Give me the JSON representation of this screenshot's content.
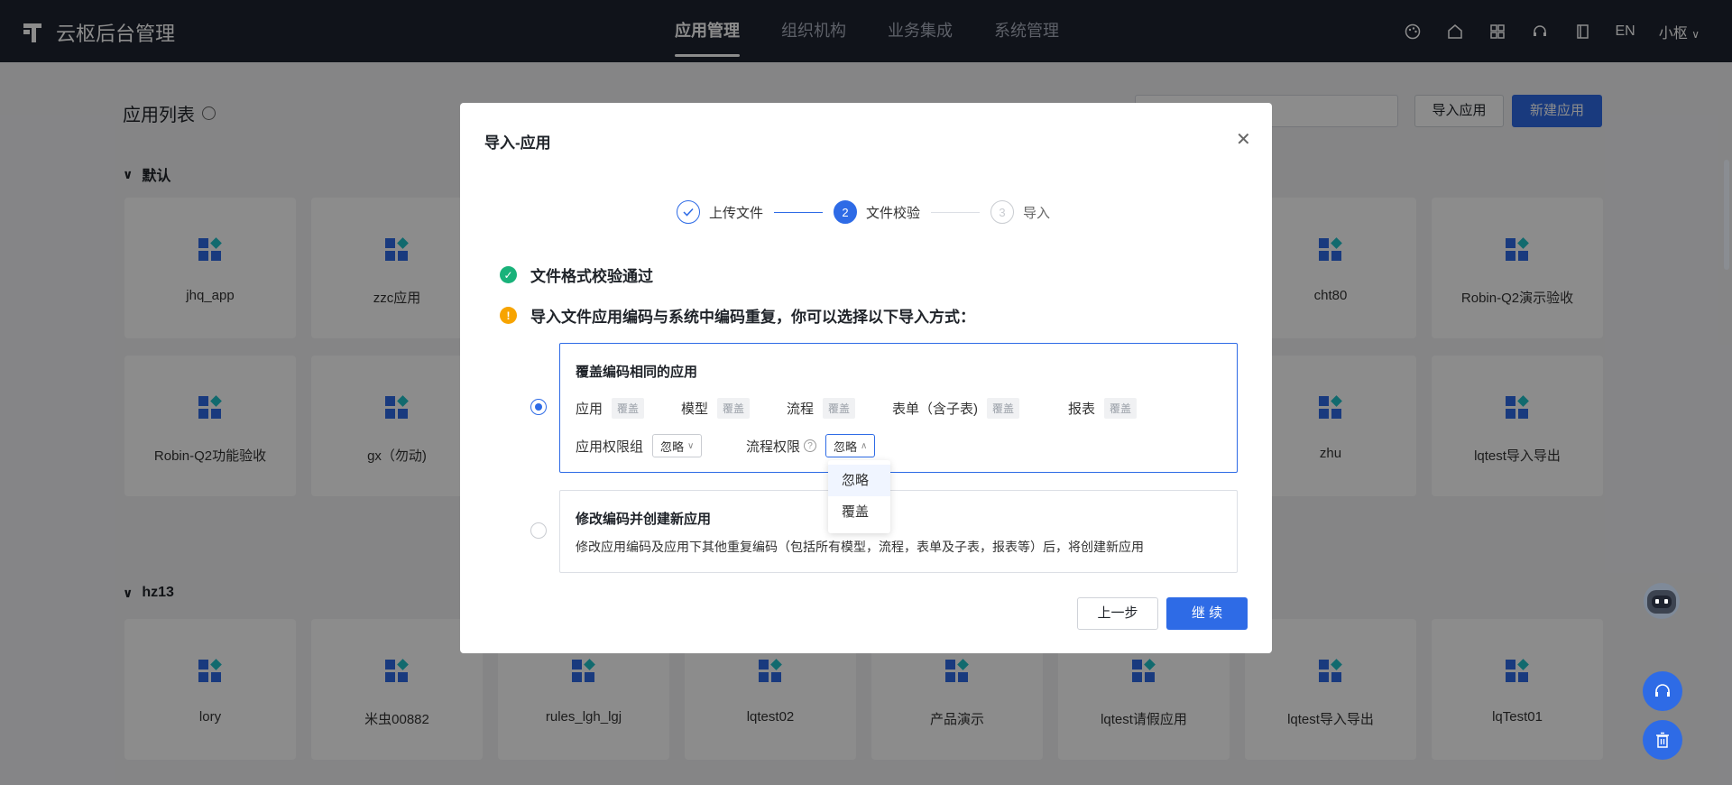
{
  "app": {
    "title": "云枢后台管理"
  },
  "nav": {
    "items": [
      "应用管理",
      "组织机构",
      "业务集成",
      "系统管理"
    ]
  },
  "topbar": {
    "icons": [
      "palette-icon",
      "home-icon",
      "grid-icon",
      "headset-icon",
      "book-icon"
    ],
    "lang": "EN",
    "user": "小枢"
  },
  "page": {
    "title": "应用列表",
    "import_label": "导入应用",
    "new_label": "新建应用"
  },
  "groups": [
    {
      "name": "默认",
      "row1": [
        "jhq_app",
        "zzc应用",
        "",
        "",
        "",
        "",
        "cht80",
        "Robin-Q2演示验收"
      ],
      "row2": [
        "Robin-Q2功能验收",
        "gx（勿动)",
        "",
        "",
        "",
        "",
        "zhu",
        "lqtest导入导出"
      ]
    },
    {
      "name": "hz13",
      "row1": [
        "lory",
        "米虫00882",
        "rules_lgh_lgj",
        "lqtest02",
        "产品演示",
        "lqtest请假应用",
        "lqtest导入导出",
        "lqTest01"
      ]
    }
  ],
  "modal": {
    "title": "导入-应用",
    "steps": [
      {
        "num": "",
        "label": "上传文件",
        "state": "done"
      },
      {
        "num": "2",
        "label": "文件校验",
        "state": "active"
      },
      {
        "num": "3",
        "label": "导入",
        "state": "pending"
      }
    ],
    "check_pass": "文件格式校验通过",
    "warning": "导入文件应用编码与系统中编码重复，你可以选择以下导入方式：",
    "option1": {
      "title": "覆盖编码相同的应用",
      "fields": [
        {
          "label": "应用",
          "tag": "覆盖"
        },
        {
          "label": "模型",
          "tag": "覆盖"
        },
        {
          "label": "流程",
          "tag": "覆盖"
        },
        {
          "label": "表单（含子表)",
          "tag": "覆盖"
        },
        {
          "label": "报表",
          "tag": "覆盖"
        }
      ],
      "perm_group_label": "应用权限组",
      "perm_group_value": "忽略",
      "flow_perm_label": "流程权限",
      "flow_perm_value": "忽略"
    },
    "dropdown_options": [
      "忽略",
      "覆盖"
    ],
    "option2": {
      "title": "修改编码并创建新应用",
      "desc": "修改应用编码及应用下其他重复编码（包括所有模型，流程，表单及子表，报表等）后，将创建新应用"
    },
    "prev_label": "上一步",
    "next_label": "继 续"
  },
  "colors": {
    "primary": "#2e6be6",
    "topbar": "#1e2330",
    "success": "#19b27a",
    "warning": "#f7a400"
  }
}
